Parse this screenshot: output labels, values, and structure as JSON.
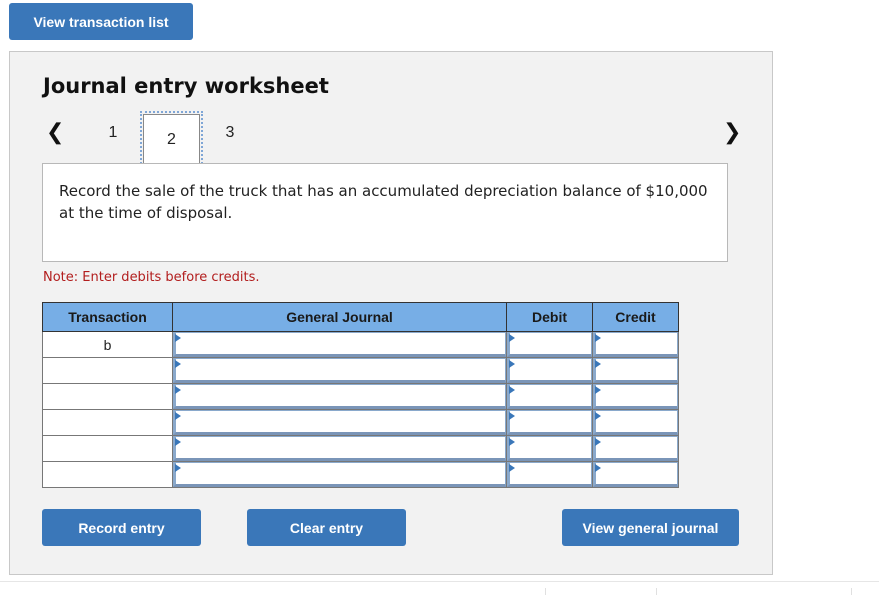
{
  "top_button": {
    "label": "View transaction list"
  },
  "worksheet": {
    "title": "Journal entry worksheet",
    "nav": {
      "prev_icon": "chevron-left-icon",
      "next_icon": "chevron-right-icon",
      "steps": [
        "1",
        "2",
        "3"
      ],
      "active_step": "2"
    },
    "prompt": "Record the sale of the truck that has an accumulated depreciation balance of $10,000 at the time of disposal.",
    "note": "Note: Enter debits before credits.",
    "table": {
      "headers": [
        "Transaction",
        "General Journal",
        "Debit",
        "Credit"
      ],
      "rows": [
        {
          "transaction": "b",
          "general_journal": "",
          "debit": "",
          "credit": ""
        },
        {
          "transaction": "",
          "general_journal": "",
          "debit": "",
          "credit": ""
        },
        {
          "transaction": "",
          "general_journal": "",
          "debit": "",
          "credit": ""
        },
        {
          "transaction": "",
          "general_journal": "",
          "debit": "",
          "credit": ""
        },
        {
          "transaction": "",
          "general_journal": "",
          "debit": "",
          "credit": ""
        },
        {
          "transaction": "",
          "general_journal": "",
          "debit": "",
          "credit": ""
        }
      ]
    },
    "buttons": {
      "record": "Record entry",
      "clear": "Clear entry",
      "view_journal": "View general journal"
    }
  },
  "colors": {
    "button_blue": "#3a77b9",
    "header_blue": "#77aee6",
    "note_red": "#b21d1d",
    "panel_bg": "#f2f2f2"
  }
}
